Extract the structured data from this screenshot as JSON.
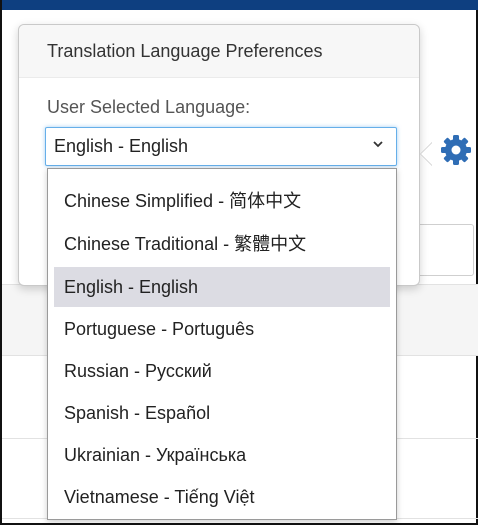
{
  "popover": {
    "title": "Translation Language Preferences",
    "field_label": "User Selected Language:",
    "selected_value": "English - English"
  },
  "dropdown": {
    "options": [
      "Chinese Simplified - 简体中文",
      "Chinese Traditional - 繁體中文",
      "English - English",
      "Portuguese - Português",
      "Russian - Русский",
      "Spanish - Español",
      "Ukrainian - Українська",
      "Vietnamese - Tiếng Việt"
    ],
    "highlighted": "English - English"
  },
  "icons": {
    "gear": "gear-icon",
    "chevron": "chevron-down-icon"
  },
  "colors": {
    "topbar": "#0e3f80",
    "gear": "#2f6db5",
    "focus_border": "#66afe9",
    "highlight": "#dcdce3"
  }
}
